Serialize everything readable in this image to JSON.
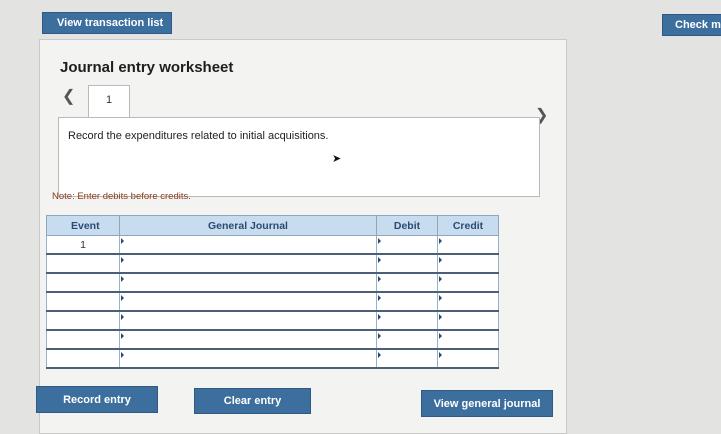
{
  "top": {
    "view_transaction_list": "View transaction list",
    "check_my_work": "Check my"
  },
  "worksheet": {
    "title": "Journal entry worksheet",
    "prev_icon": "chevron-left-icon",
    "next_icon": "chevron-right-icon",
    "tabs": [
      "1"
    ],
    "instruction": "Record the expenditures related to initial acquisitions.",
    "note": "Note: Enter debits before credits."
  },
  "table": {
    "headers": {
      "event": "Event",
      "general_journal": "General Journal",
      "debit": "Debit",
      "credit": "Credit"
    },
    "rows": [
      {
        "event": "1",
        "general_journal": "",
        "debit": "",
        "credit": ""
      },
      {
        "event": "",
        "general_journal": "",
        "debit": "",
        "credit": ""
      },
      {
        "event": "",
        "general_journal": "",
        "debit": "",
        "credit": ""
      },
      {
        "event": "",
        "general_journal": "",
        "debit": "",
        "credit": ""
      },
      {
        "event": "",
        "general_journal": "",
        "debit": "",
        "credit": ""
      },
      {
        "event": "",
        "general_journal": "",
        "debit": "",
        "credit": ""
      },
      {
        "event": "",
        "general_journal": "",
        "debit": "",
        "credit": ""
      }
    ]
  },
  "actions": {
    "record_entry": "Record entry",
    "clear_entry": "Clear entry",
    "view_general_journal": "View general journal"
  }
}
